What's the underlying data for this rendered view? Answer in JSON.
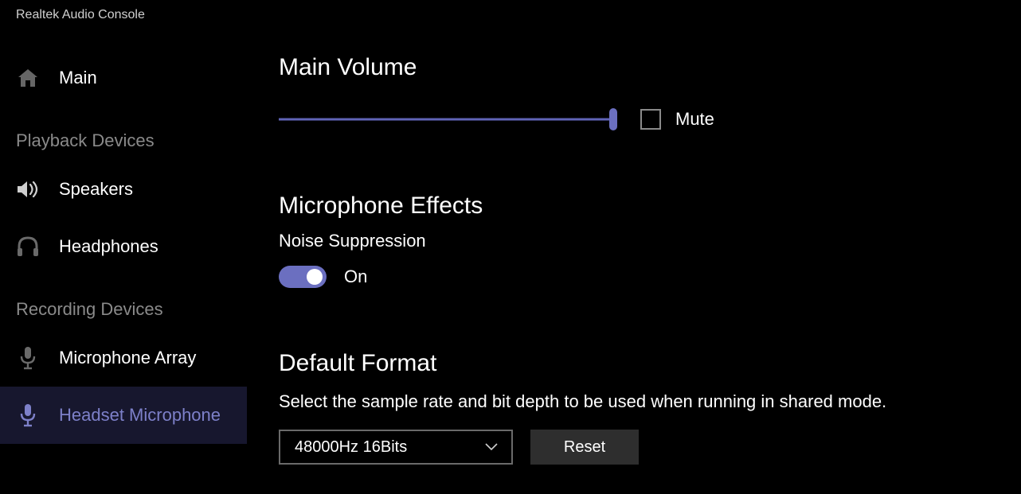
{
  "app_title": "Realtek Audio Console",
  "sidebar": {
    "main_label": "Main",
    "playback_heading": "Playback Devices",
    "speakers_label": "Speakers",
    "headphones_label": "Headphones",
    "recording_heading": "Recording Devices",
    "mic_array_label": "Microphone Array",
    "headset_mic_label": "Headset Microphone"
  },
  "main_volume": {
    "heading": "Main Volume",
    "value_pct": 100,
    "mute_label": "Mute",
    "mute_checked": false
  },
  "effects": {
    "heading": "Microphone Effects",
    "noise_suppression_label": "Noise Suppression",
    "noise_suppression_state_label": "On",
    "noise_suppression_on": true
  },
  "default_format": {
    "heading": "Default Format",
    "description": "Select the sample rate and bit depth to be used when running in shared mode.",
    "selected": "48000Hz 16Bits",
    "reset_label": "Reset"
  }
}
